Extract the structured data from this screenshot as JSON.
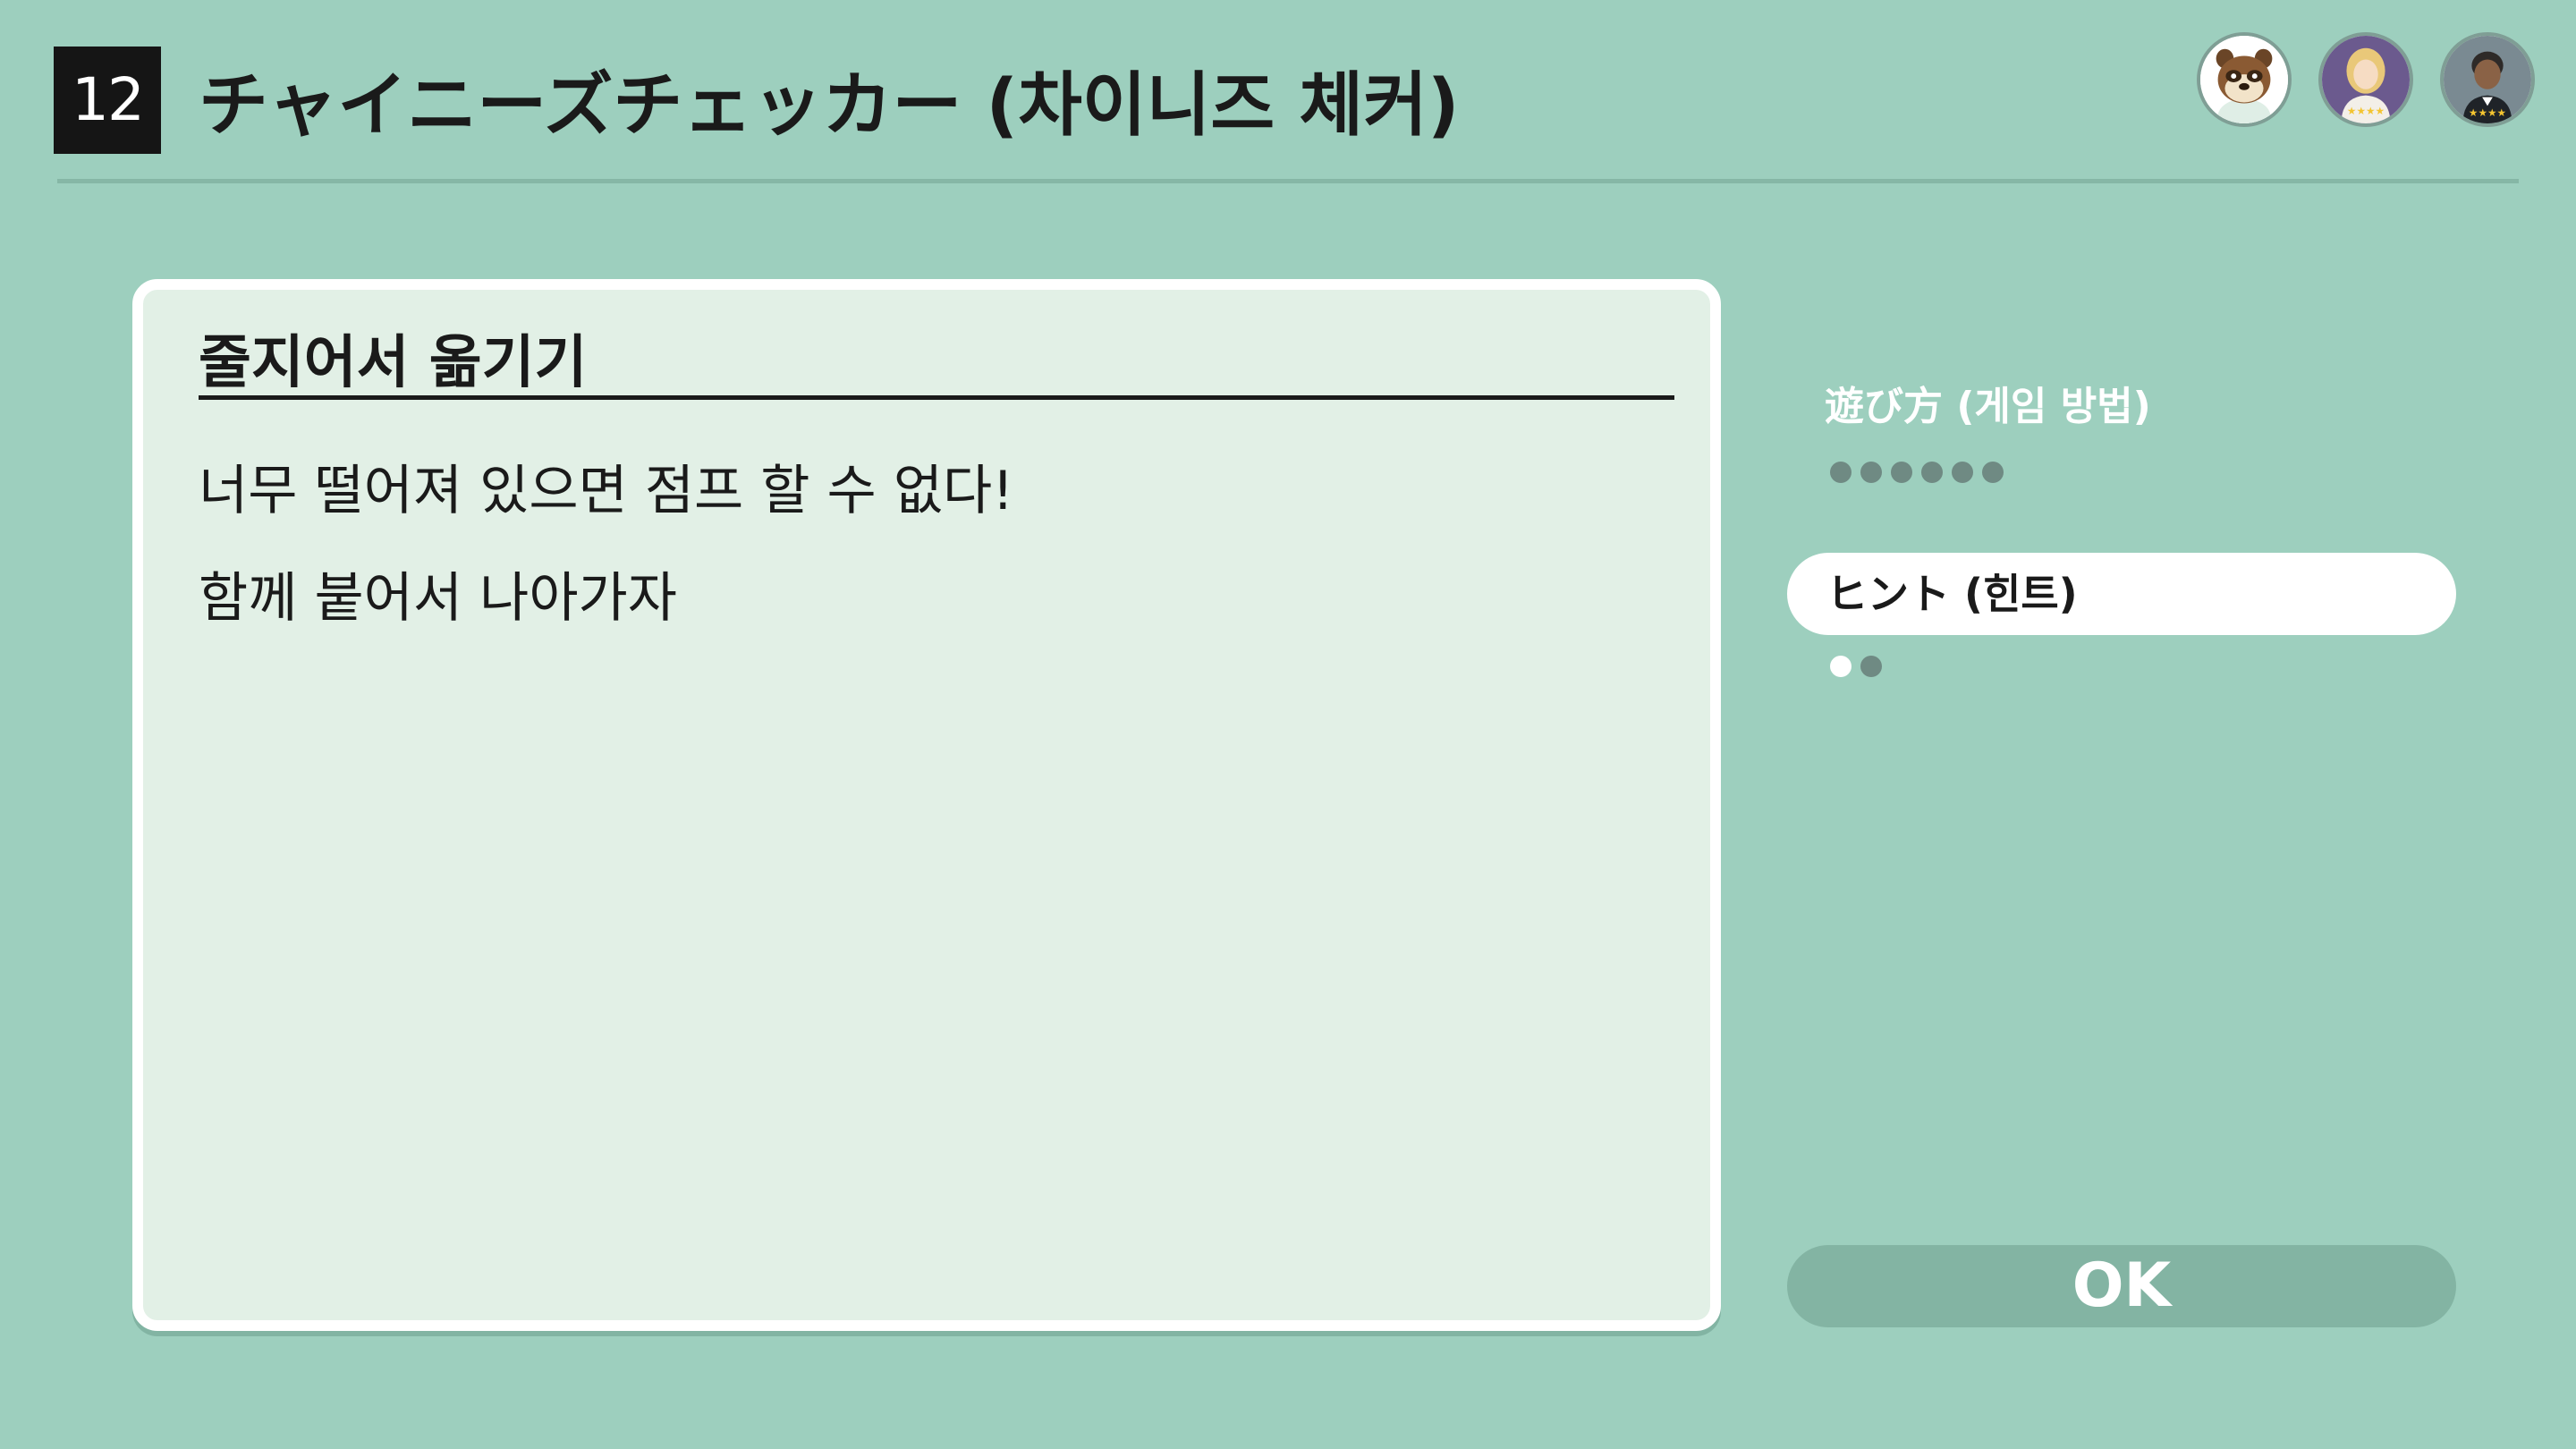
{
  "header": {
    "game_number": "12",
    "title": "チャイニーズチェッカー (차이니즈 체커)"
  },
  "players": [
    {
      "icon": "tanuki-avatar-icon"
    },
    {
      "icon": "blonde-player-avatar-icon",
      "stars": "★★★★"
    },
    {
      "icon": "dark-haired-player-avatar-icon",
      "stars": "★★★★"
    }
  ],
  "panel": {
    "heading": "줄지어서 옮기기",
    "lines": [
      "너무 떨어져 있으면 점프 할 수 없다!",
      "함께 붙어서 나아가자"
    ]
  },
  "menu": {
    "howto_label": "遊び方 (게임 방법)",
    "howto_pages": 6,
    "howto_current": 0,
    "hint_label": "ヒント (힌트)",
    "hint_pages": 2,
    "hint_current": 1
  },
  "ok_label": "OK",
  "colors": {
    "background": "#9dcfbe",
    "panel": "#e2f0e6",
    "dot_inactive": "#6f8a83",
    "dot_active": "#ffffff",
    "ok_button": "#83b4a3"
  }
}
